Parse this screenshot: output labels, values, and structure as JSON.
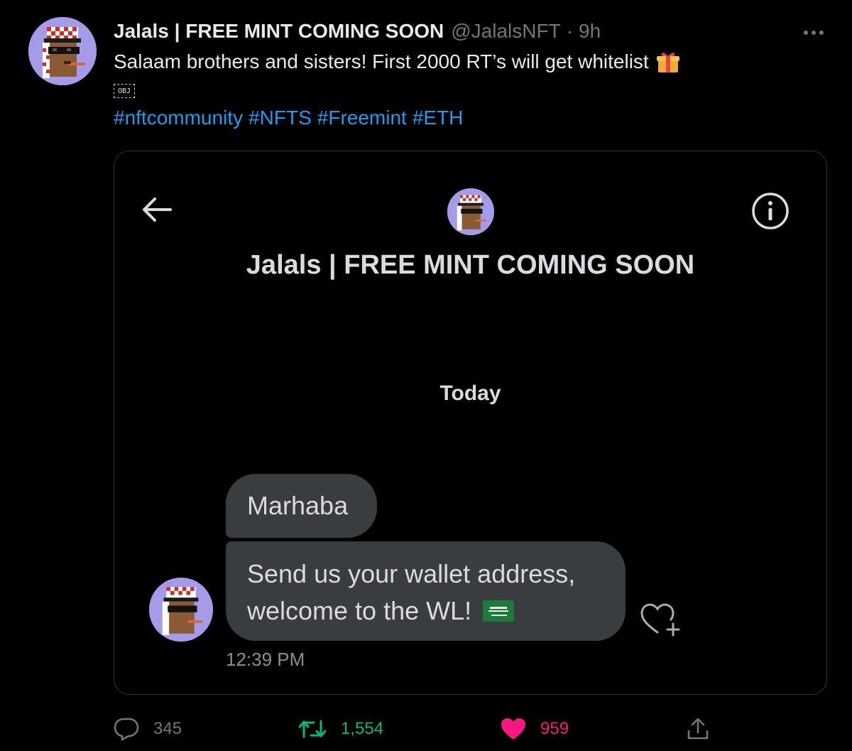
{
  "tweet": {
    "display_name": "Jalals | FREE MINT COMING SOON",
    "handle": "@JalalsNFT",
    "separator": "·",
    "time": "9h",
    "text": "Salaam brothers and sisters! First 2000 RT’s will get whitelist",
    "obj_placeholder": "OBJ",
    "hashtags": [
      "#nftcommunity",
      "#NFTS",
      "#Freemint",
      "#ETH"
    ]
  },
  "dm": {
    "title": "Jalals | FREE MINT COMING SOON",
    "day_label": "Today",
    "messages": [
      {
        "text": "Marhaba"
      },
      {
        "line1": "Send us your wallet address,",
        "line2": "welcome to the WL!"
      }
    ],
    "message_time": "12:39 PM"
  },
  "actions": {
    "reply_count": "345",
    "retweet_count": "1,554",
    "like_count": "959"
  },
  "colors": {
    "background": "#000000",
    "link": "#1d9bf0",
    "retweet": "#00ba7c",
    "like": "#f91880",
    "bubble": "#3a3d40"
  },
  "icons": [
    "more-icon",
    "gift-emoji-icon",
    "back-arrow-icon",
    "info-icon",
    "saudi-flag-emoji-icon",
    "heart-plus-icon",
    "reply-icon",
    "retweet-icon",
    "heart-filled-icon",
    "share-icon"
  ]
}
